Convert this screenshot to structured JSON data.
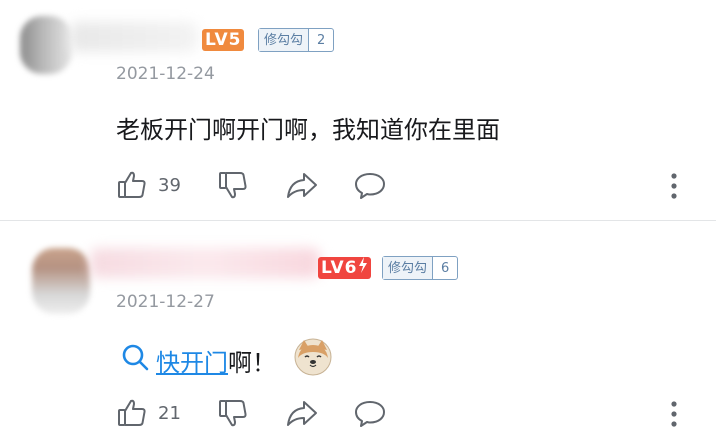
{
  "comments": [
    {
      "level_label": "LV5",
      "level_color": "#f08a3e",
      "medal_name": "修勾勾",
      "medal_level": "2",
      "date": "2021-12-24",
      "text": "老板开门啊开门啊，我知道你在里面",
      "likes": "39"
    },
    {
      "level_label": "LV6",
      "level_color": "#f0453f",
      "medal_name": "修勾勾",
      "medal_level": "6",
      "date": "2021-12-27",
      "link_text": "快开门",
      "text_suffix": "啊！",
      "likes": "21"
    }
  ],
  "icons": {
    "like": "thumbs-up-icon",
    "dislike": "thumbs-down-icon",
    "share": "share-icon",
    "reply": "comment-bubble-icon",
    "more": "more-vertical-icon",
    "search": "search-icon",
    "emoji": "shiba-dog-emoji",
    "lightning": "lightning-icon"
  },
  "colors": {
    "link": "#1e88e5",
    "muted": "#9499a0",
    "divider": "#e3e5e7"
  }
}
